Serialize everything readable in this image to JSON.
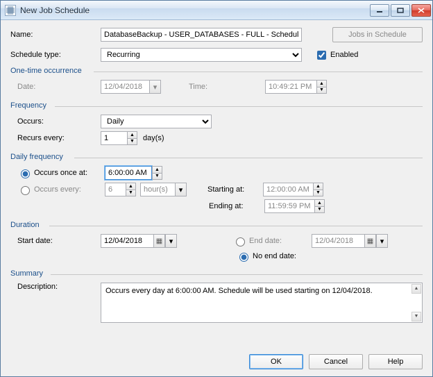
{
  "window": {
    "title": "New Job Schedule"
  },
  "header": {
    "name_label": "Name:",
    "name_value": "DatabaseBackup - USER_DATABASES - FULL - Schedule",
    "jobs_btn": "Jobs in Schedule",
    "type_label": "Schedule type:",
    "type_value": "Recurring",
    "enabled_label": "Enabled"
  },
  "onetime": {
    "legend": "One-time occurrence",
    "date_label": "Date:",
    "date_value": "12/04/2018",
    "time_label": "Time:",
    "time_value": "10:49:21 PM"
  },
  "frequency": {
    "legend": "Frequency",
    "occurs_label": "Occurs:",
    "occurs_value": "Daily",
    "recurs_label": "Recurs every:",
    "recurs_value": "1",
    "recurs_unit": "day(s)"
  },
  "daily": {
    "legend": "Daily frequency",
    "once_label": "Occurs once at:",
    "once_value": "6:00:00 AM",
    "every_label": "Occurs every:",
    "every_value": "6",
    "every_unit": "hour(s)",
    "start_label": "Starting at:",
    "start_value": "12:00:00 AM",
    "end_label": "Ending at:",
    "end_value": "11:59:59 PM"
  },
  "duration": {
    "legend": "Duration",
    "start_label": "Start date:",
    "start_value": "12/04/2018",
    "end_label": "End date:",
    "end_value": "12/04/2018",
    "noend_label": "No end date:"
  },
  "summary": {
    "legend": "Summary",
    "desc_label": "Description:",
    "desc_value": "Occurs every day at 6:00:00 AM. Schedule will be used starting on 12/04/2018."
  },
  "buttons": {
    "ok": "OK",
    "cancel": "Cancel",
    "help": "Help"
  }
}
